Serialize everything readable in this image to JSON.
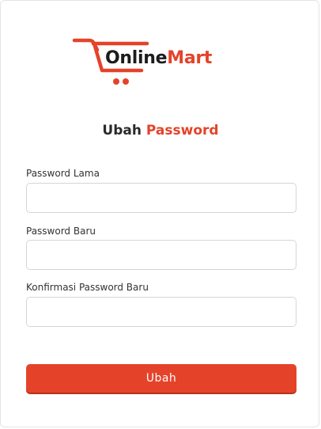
{
  "brand": {
    "name_part1": "Online",
    "name_part2": "Mart",
    "accent_color": "#e4432a",
    "dark_color": "#1c1c1c",
    "logo_icon": "shopping-cart-icon"
  },
  "page": {
    "title_part1": "Ubah",
    "title_part2": "Password"
  },
  "form": {
    "fields": [
      {
        "label": "Password Lama",
        "value": "",
        "placeholder": ""
      },
      {
        "label": "Password Baru",
        "value": "",
        "placeholder": ""
      },
      {
        "label": "Konfirmasi Password Baru",
        "value": "",
        "placeholder": ""
      }
    ],
    "submit_label": "Ubah",
    "submit_color": "#e4432a"
  }
}
